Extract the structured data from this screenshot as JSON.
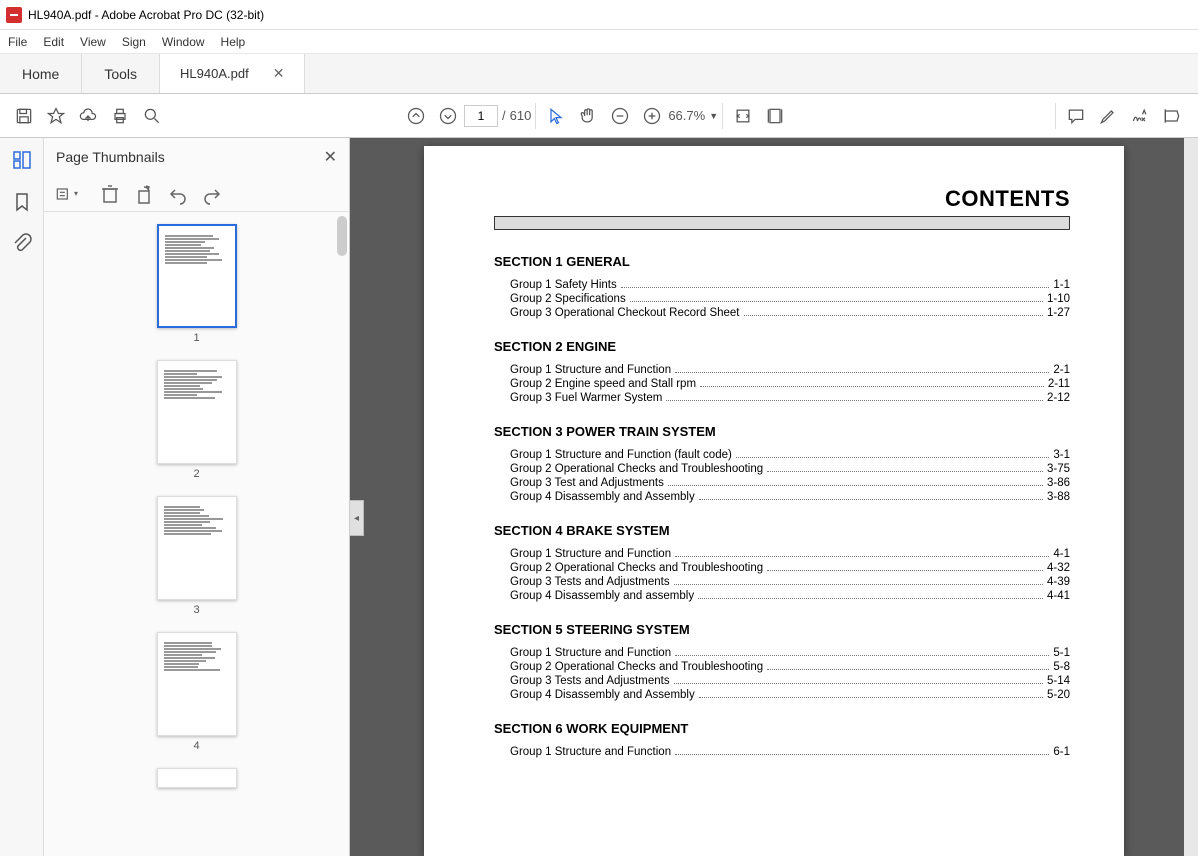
{
  "title": "HL940A.pdf - Adobe Acrobat Pro DC (32-bit)",
  "menu": {
    "file": "File",
    "edit": "Edit",
    "view": "View",
    "sign": "Sign",
    "window": "Window",
    "help": "Help"
  },
  "tabs": {
    "home": "Home",
    "tools": "Tools",
    "doc": "HL940A.pdf"
  },
  "toolbar": {
    "page_current": "1",
    "page_sep": "/",
    "page_total": "610",
    "zoom": "66.7%"
  },
  "panel": {
    "title": "Page Thumbnails"
  },
  "thumbs": [
    {
      "n": "1"
    },
    {
      "n": "2"
    },
    {
      "n": "3"
    },
    {
      "n": "4"
    }
  ],
  "doc": {
    "contents_title": "CONTENTS",
    "sections": [
      {
        "head": "SECTION 1  GENERAL",
        "groups": [
          {
            "label": "Group   1  Safety Hints",
            "page": "1-1"
          },
          {
            "label": "Group   2  Specifications",
            "page": "1-10"
          },
          {
            "label": "Group   3  Operational Checkout Record Sheet",
            "page": "1-27"
          }
        ]
      },
      {
        "head": "SECTION 2  ENGINE",
        "groups": [
          {
            "label": "Group   1  Structure and Function",
            "page": "2-1"
          },
          {
            "label": "Group   2  Engine speed and Stall rpm",
            "page": "2-11"
          },
          {
            "label": "Group   3  Fuel Warmer System",
            "page": "2-12"
          }
        ]
      },
      {
        "head": "SECTION 3  POWER TRAIN SYSTEM",
        "groups": [
          {
            "label": "Group   1  Structure and Function (fault code)",
            "page": "3-1"
          },
          {
            "label": "Group   2  Operational Checks and Troubleshooting",
            "page": "3-75"
          },
          {
            "label": "Group   3  Test and Adjustments",
            "page": "3-86"
          },
          {
            "label": "Group   4  Disassembly and Assembly",
            "page": "3-88"
          }
        ]
      },
      {
        "head": "SECTION 4  BRAKE SYSTEM",
        "groups": [
          {
            "label": "Group   1  Structure and Function",
            "page": "4-1"
          },
          {
            "label": "Group   2  Operational Checks and Troubleshooting",
            "page": "4-32"
          },
          {
            "label": "Group   3  Tests and Adjustments",
            "page": "4-39"
          },
          {
            "label": "Group   4  Disassembly and assembly",
            "page": "4-41"
          }
        ]
      },
      {
        "head": "SECTION 5  STEERING SYSTEM",
        "groups": [
          {
            "label": "Group   1  Structure and Function",
            "page": "5-1"
          },
          {
            "label": "Group   2  Operational Checks and Troubleshooting",
            "page": "5-8"
          },
          {
            "label": "Group   3  Tests and Adjustments",
            "page": "5-14"
          },
          {
            "label": "Group   4  Disassembly and Assembly",
            "page": "5-20"
          }
        ]
      },
      {
        "head": "SECTION 6  WORK EQUIPMENT",
        "groups": [
          {
            "label": "Group   1  Structure and Function",
            "page": "6-1"
          }
        ]
      }
    ]
  }
}
